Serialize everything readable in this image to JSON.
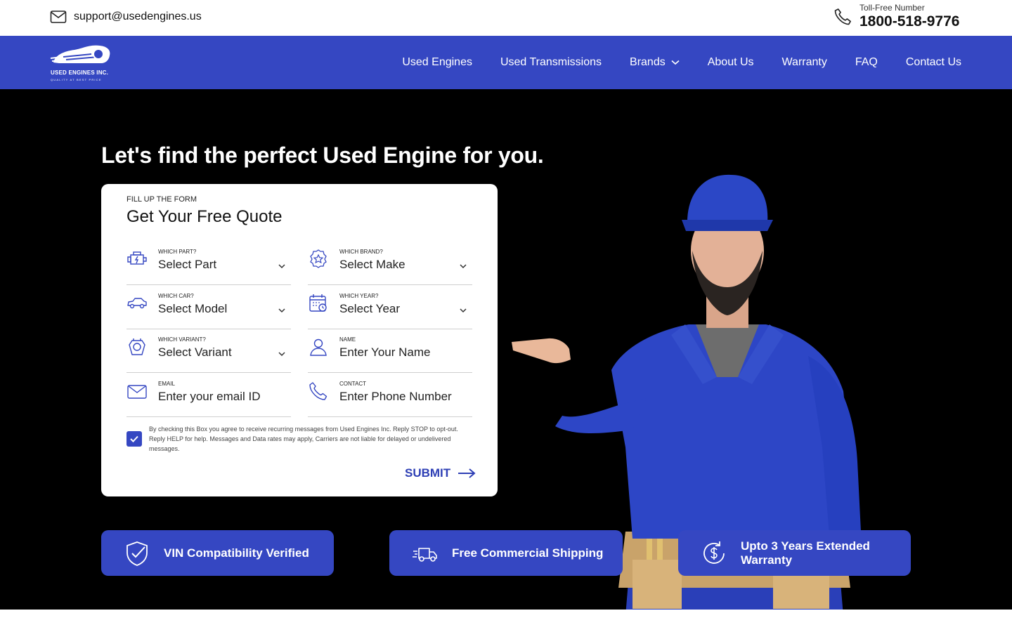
{
  "topbar": {
    "email": "support@usedengines.us",
    "phone_caption": "Toll-Free Number",
    "phone_number": "1800-518-9776"
  },
  "logo": {
    "name": "USED ENGINES INC.",
    "tagline": "QUALITY AT BEST PRICE"
  },
  "nav": {
    "items": [
      {
        "label": "Used Engines"
      },
      {
        "label": "Used Transmissions"
      },
      {
        "label": "Brands"
      },
      {
        "label": "About Us"
      },
      {
        "label": "Warranty"
      },
      {
        "label": "FAQ"
      },
      {
        "label": "Contact Us"
      }
    ]
  },
  "hero": {
    "headline": "Let's find the perfect Used Engine for you."
  },
  "form": {
    "eyebrow": "FILL UP THE FORM",
    "title": "Get Your Free Quote",
    "fields": {
      "part": {
        "label": "WHICH PART?",
        "value": "Select Part"
      },
      "brand": {
        "label": "WHICH BRAND?",
        "value": "Select Make"
      },
      "car": {
        "label": "WHICH CAR?",
        "value": "Select Model"
      },
      "year": {
        "label": "WHICH YEAR?",
        "value": "Select Year"
      },
      "variant": {
        "label": "WHICH VARIANT?",
        "value": "Select Variant"
      },
      "name": {
        "label": "NAME",
        "placeholder": "Enter Your Name"
      },
      "email": {
        "label": "EMAIL",
        "placeholder": "Enter your email ID"
      },
      "contact": {
        "label": "CONTACT",
        "placeholder": "Enter Phone Number"
      }
    },
    "consent_text": "By checking this Box you agree to receive recurring messages from Used Engines Inc. Reply STOP to opt-out. Reply HELP for help. Messages and Data rates may apply, Carriers are not liable for delayed or undelivered messages.",
    "consent_checked": true,
    "submit_label": "SUBMIT"
  },
  "features": {
    "vin": "VIN Compatibility Verified",
    "shipping": "Free Commercial Shipping",
    "warranty_line1": "Upto 3 Years Extended",
    "warranty_line2": "Warranty"
  },
  "colors": {
    "brand_blue": "#3547c2",
    "accent_text": "#2e3fb5"
  }
}
